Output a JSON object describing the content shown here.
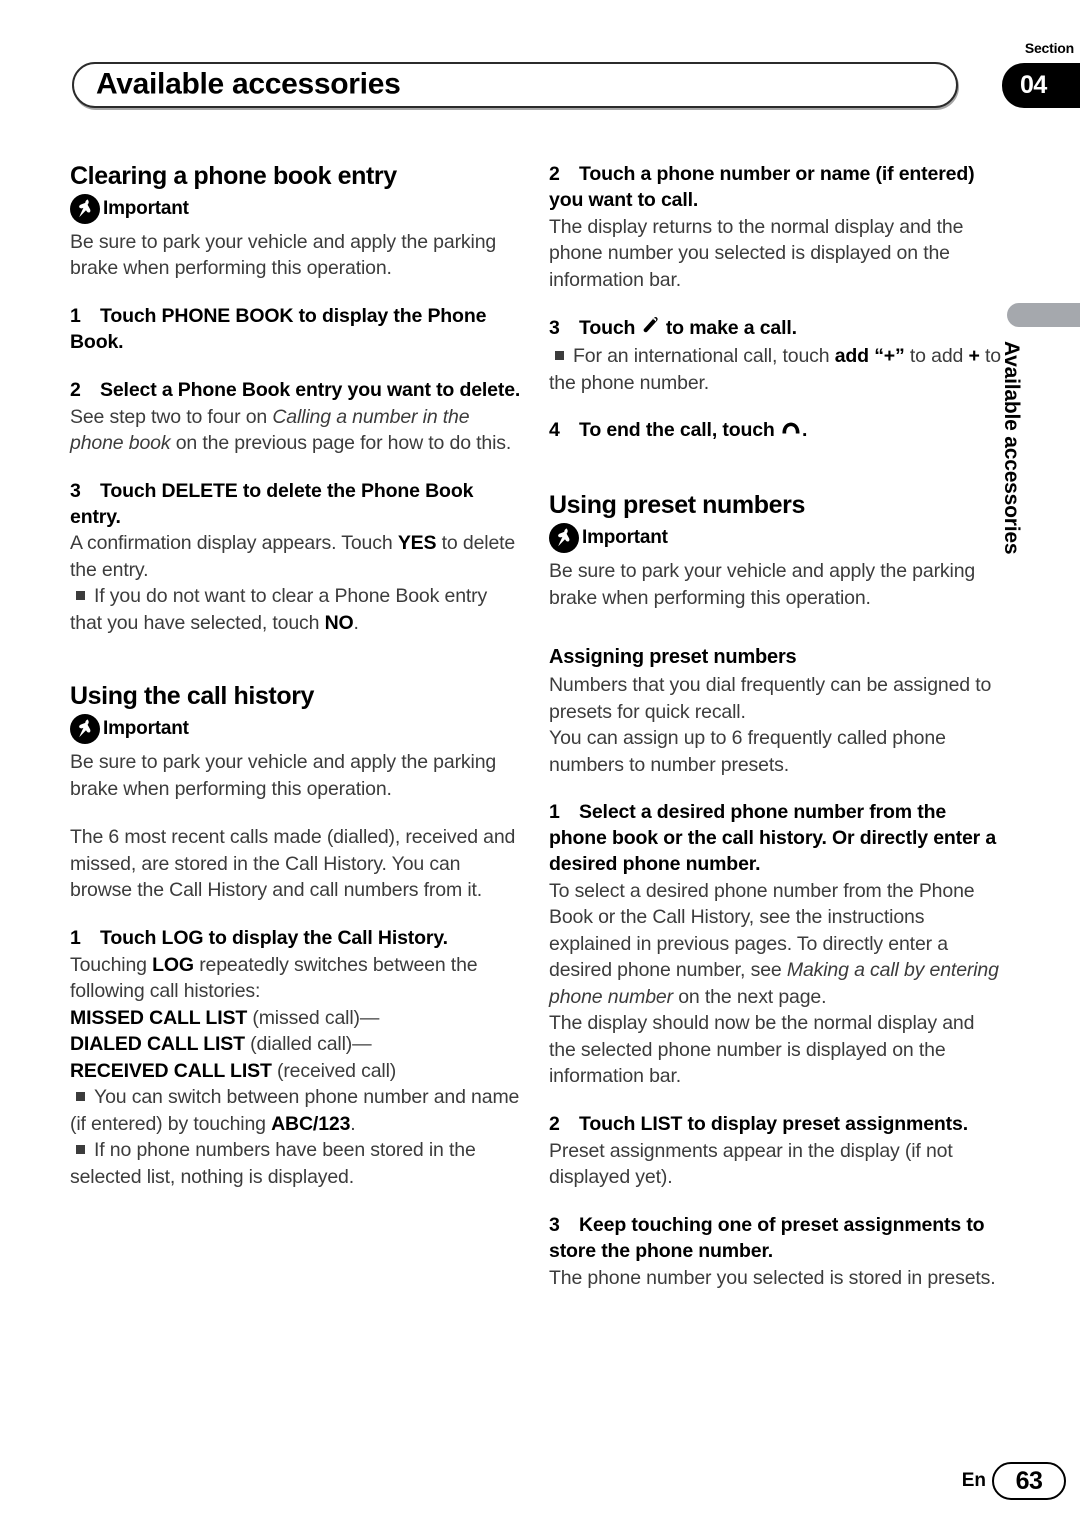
{
  "header": {
    "title": "Available accessories",
    "section_label": "Section",
    "section_number": "04"
  },
  "side_tab": {
    "text": "Available accessories"
  },
  "footer": {
    "language": "En",
    "page_number": "63"
  },
  "icons": {
    "pin": "pushpin-icon",
    "handset_offhook": "phone-offhook-icon",
    "handset_onhook": "phone-onhook-icon"
  },
  "left_column": {
    "heading_clearing": "Clearing a phone book entry",
    "important_label": "Important",
    "important_body": "Be sure to park your vehicle and apply the parking brake when performing this operation.",
    "step1_num": "1",
    "step1_text": "Touch PHONE BOOK to display the Phone Book.",
    "step2_num": "2",
    "step2_text": "Select a Phone Book entry you want to delete.",
    "step2_body_pre": "See step two to four on ",
    "step2_body_italic": "Calling a number in the phone book",
    "step2_body_post": " on the previous page for how to do this.",
    "step3_num": "3",
    "step3_text": "Touch DELETE to delete the Phone Book entry.",
    "step3_body_pre": "A confirmation display appears. Touch ",
    "step3_body_bold": "YES",
    "step3_body_post": " to delete the entry.",
    "step3_bullet_pre": "If you do not want to clear a Phone Book entry that you have selected, touch ",
    "step3_bullet_bold": "NO",
    "step3_bullet_post": ".",
    "heading_call_history": "Using the call history",
    "call_history_intro": "The 6 most recent calls made (dialled), received and missed, are stored in the Call History. You can browse the Call History and call numbers from it.",
    "ch_step1_num": "1",
    "ch_step1_text": "Touch LOG to display the Call History.",
    "ch_body_pre": "Touching ",
    "ch_body_bold": "LOG",
    "ch_body_post": " repeatedly switches between the following call histories:",
    "list_missed_bold": "MISSED CALL LIST",
    "list_missed_rest": " (missed call)—",
    "list_dialed_bold": "DIALED CALL LIST",
    "list_dialed_rest": " (dialled call)—",
    "list_received_bold": "RECEIVED CALL LIST",
    "list_received_rest": " (received call)",
    "ch_bullet1_pre": "You can switch between phone number and name (if entered) by touching ",
    "ch_bullet1_bold": "ABC/123",
    "ch_bullet1_post": ".",
    "ch_bullet2": "If no phone numbers have been stored in the selected list, nothing is displayed."
  },
  "right_column": {
    "step2_num": "2",
    "step2_text": "Touch a phone number or name (if entered) you want to call.",
    "step2_body": "The display returns to the normal display and the phone number you selected is displayed on the information bar.",
    "step3_num": "3",
    "step3_text_pre": "Touch ",
    "step3_text_post": " to make a call.",
    "step3_bullet_pre": "For an international call, touch ",
    "step3_bullet_bold": "add “+”",
    "step3_bullet_mid": " to add ",
    "step3_bullet_plus": "+",
    "step3_bullet_post": " to the phone number.",
    "step4_num": "4",
    "step4_text_pre": "To end the call, touch ",
    "step4_text_post": ".",
    "heading_preset": "Using preset numbers",
    "important_label": "Important",
    "important_body": "Be sure to park your vehicle and apply the parking brake when performing this operation.",
    "subheading_assigning": "Assigning preset numbers",
    "assigning_body1": "Numbers that you dial frequently can be assigned to presets for quick recall.",
    "assigning_body2": "You can assign up to 6 frequently called phone numbers to number presets.",
    "ap_step1_num": "1",
    "ap_step1_text": "Select a desired phone number from the phone book or the call history. Or directly enter a desired phone number.",
    "ap_step1_body_pre": "To select a desired phone number from the Phone Book or the Call History, see the instructions explained in previous pages. To directly enter a desired phone number, see ",
    "ap_step1_body_italic": "Making a call by entering phone number",
    "ap_step1_body_post": " on the next page.",
    "ap_step1_body2": "The display should now be the normal display and the selected phone number is displayed on the information bar.",
    "ap_step2_num": "2",
    "ap_step2_text": "Touch LIST to display preset assignments.",
    "ap_step2_body": "Preset assignments appear in the display (if not displayed yet).",
    "ap_step3_num": "3",
    "ap_step3_text": "Keep touching one of preset assignments to store the phone number.",
    "ap_step3_body": "The phone number you selected is stored in presets."
  }
}
